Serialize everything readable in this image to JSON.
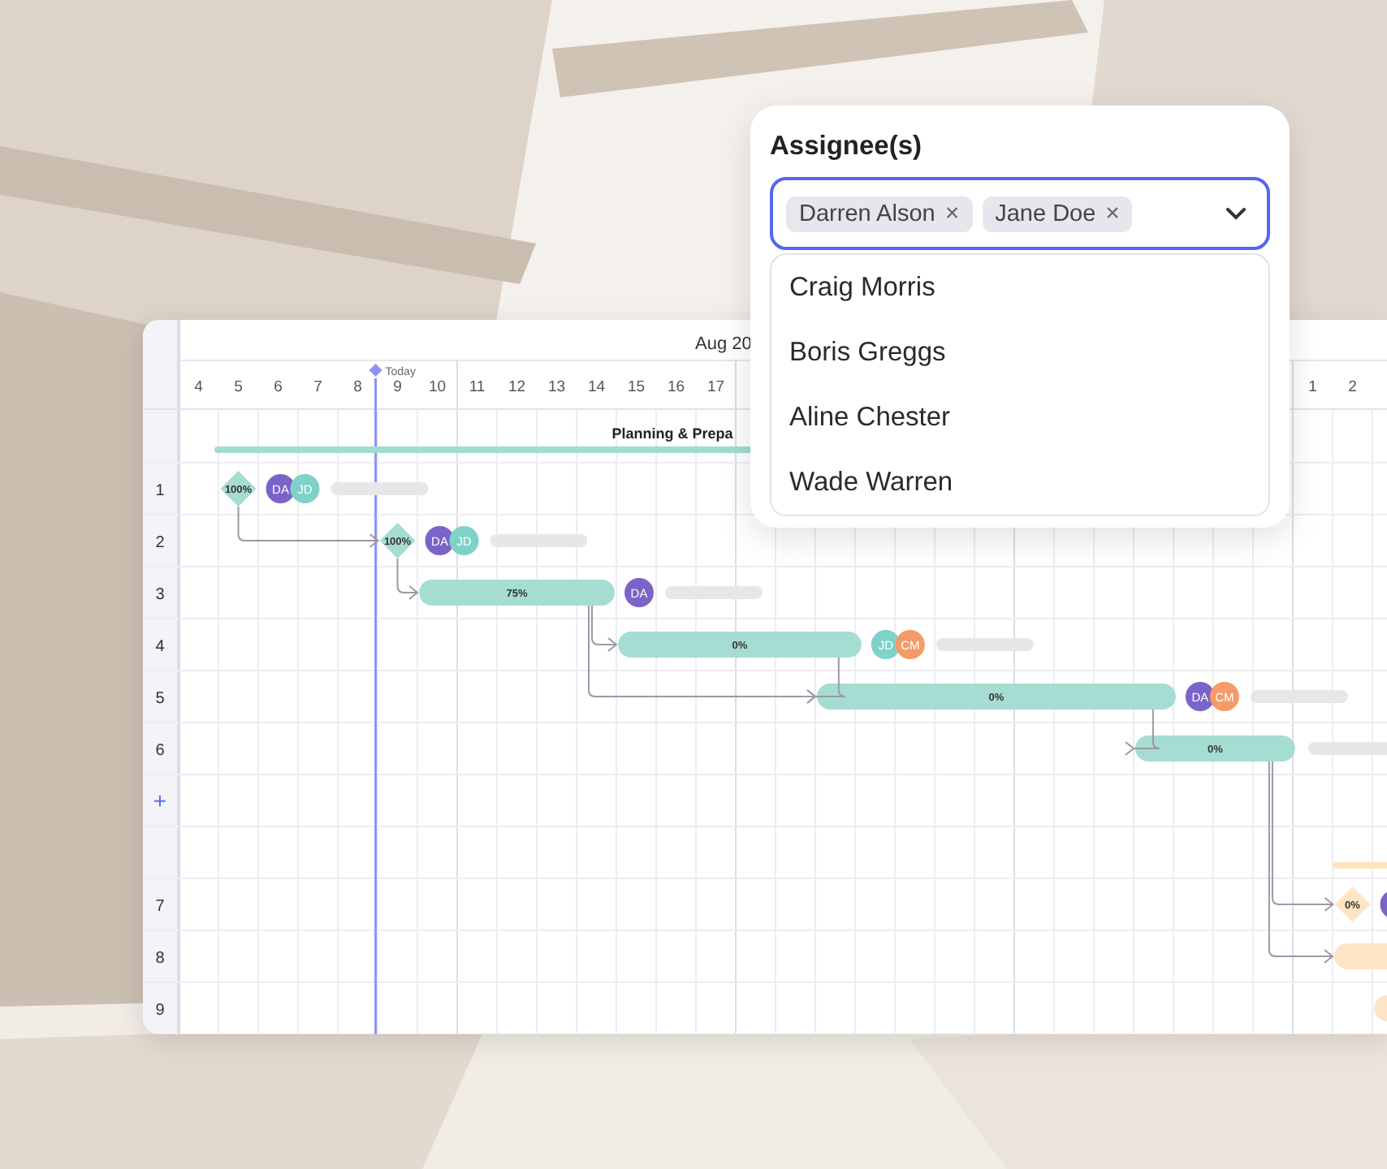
{
  "timeline": {
    "month": "Aug 20",
    "days": [
      "4",
      "5",
      "6",
      "7",
      "8",
      "9",
      "10",
      "11",
      "12",
      "13",
      "14",
      "15",
      "16",
      "17"
    ],
    "next_month_days": [
      "1",
      "2"
    ],
    "today": {
      "label": "Today"
    }
  },
  "rows": [
    {
      "kind": "summary",
      "title": "Planning & Prepa",
      "color": "#9fdccf"
    },
    {
      "kind": "milestone",
      "number": "1",
      "progress": "100%",
      "color": "#a6ddd2",
      "assignees": [
        {
          "initials": "DA",
          "color": "#7a64c8"
        },
        {
          "initials": "JD",
          "color": "#80d1c8"
        }
      ]
    },
    {
      "kind": "milestone",
      "number": "2",
      "progress": "100%",
      "color": "#a6ddd2",
      "assignees": [
        {
          "initials": "DA",
          "color": "#7a64c8"
        },
        {
          "initials": "JD",
          "color": "#80d1c8"
        }
      ]
    },
    {
      "kind": "bar",
      "number": "3",
      "progress": "75%",
      "color": "#a6ddd2",
      "assignees": [
        {
          "initials": "DA",
          "color": "#7a64c8"
        }
      ]
    },
    {
      "kind": "bar",
      "number": "4",
      "progress": "0%",
      "color": "#a6ddd2",
      "assignees": [
        {
          "initials": "JD",
          "color": "#80d1c8"
        },
        {
          "initials": "CM",
          "color": "#f59a68"
        }
      ]
    },
    {
      "kind": "bar",
      "number": "5",
      "progress": "0%",
      "color": "#a6ddd2",
      "assignees": [
        {
          "initials": "DA",
          "color": "#7a64c8"
        },
        {
          "initials": "CM",
          "color": "#f59a68"
        }
      ]
    },
    {
      "kind": "bar",
      "number": "6",
      "progress": "0%",
      "color": "#a6ddd2"
    },
    {
      "kind": "add",
      "label": "+"
    },
    {
      "kind": "summary",
      "color": "#fde3be"
    },
    {
      "kind": "milestone",
      "number": "7",
      "progress": "0%",
      "color": "#fde4c4",
      "assignees": [
        {
          "color": "#7a64c8"
        }
      ]
    },
    {
      "kind": "bar",
      "number": "8",
      "color": "#fde4c4"
    },
    {
      "kind": "bar",
      "number": "9",
      "color": "#fde4c4"
    }
  ],
  "assignee_picker": {
    "label": "Assignee(s)",
    "focused": true,
    "chips": [
      "Darren Alson",
      "Jane Doe"
    ],
    "remove_glyph": "×",
    "options": [
      "Craig Morris",
      "Boris Greggs",
      "Aline Chester",
      "Wade Warren"
    ]
  }
}
